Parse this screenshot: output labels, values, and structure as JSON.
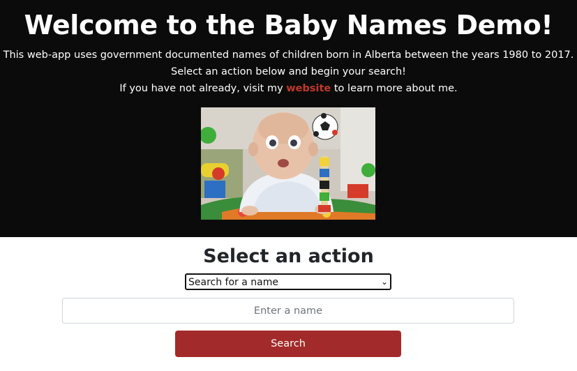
{
  "hero": {
    "title": "Welcome to the Baby Names Demo!",
    "line1": "This web-app uses government documented names of children born in Alberta between the years 1980 to 2017.",
    "line2": "Select an action below and begin your search!",
    "line3_prefix": "If you have not already, visit my ",
    "line3_link": "website",
    "line3_suffix": " to learn more about me.",
    "image_label": "surprised baby gif"
  },
  "action": {
    "title": "Select an action",
    "selected_option": "Search for a name"
  },
  "search": {
    "placeholder": "Enter a name",
    "button_label": "Search"
  },
  "colors": {
    "hero_background": "#0b0b0b",
    "accent": "#a32a2a",
    "link": "#c0392b"
  }
}
